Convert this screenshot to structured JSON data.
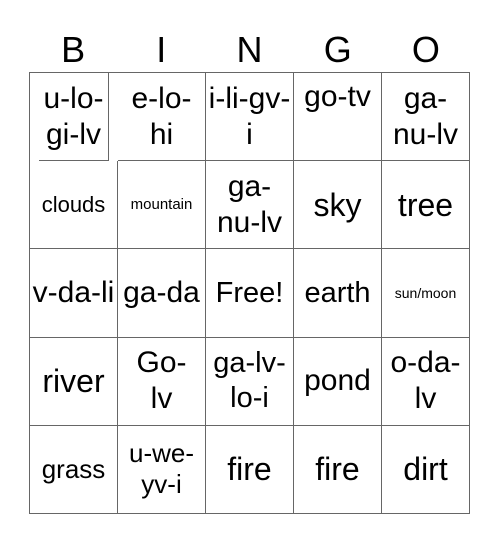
{
  "header": [
    "B",
    "I",
    "N",
    "G",
    "O"
  ],
  "cells": [
    [
      "u-lo-gi-lv",
      "e-lo-hi",
      "i-li-gv-i",
      "go-tv",
      "ga-nu-lv"
    ],
    [
      "clouds",
      "mountain",
      "ga-nu-lv",
      "sky",
      "tree"
    ],
    [
      "v-da-li",
      "ga-da",
      "Free!",
      "earth",
      "sun/moon"
    ],
    [
      "river",
      "Go-lv",
      "ga-lv-lo-i",
      "pond",
      "o-da-lv"
    ],
    [
      "grass",
      "u-we-yv-i",
      "fire",
      "fire",
      "dirt"
    ]
  ]
}
